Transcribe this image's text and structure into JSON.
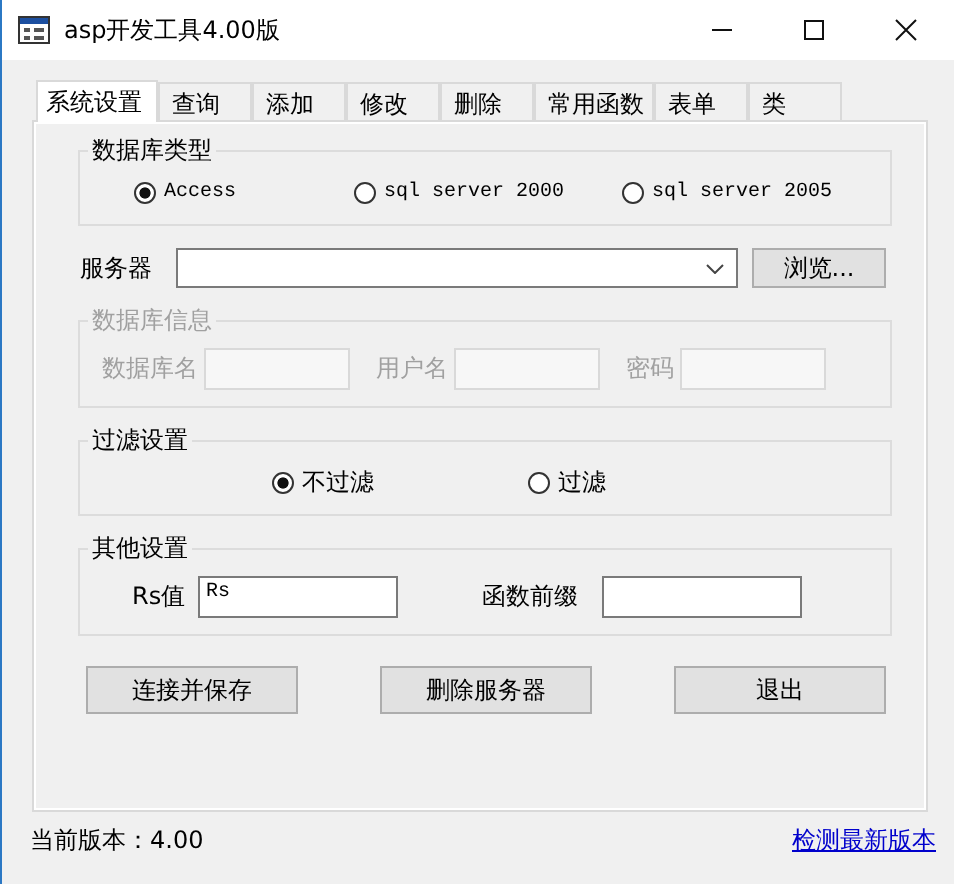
{
  "window": {
    "title": "asp开发工具4.00版"
  },
  "tabs": [
    {
      "label": "系统设置",
      "selected": true
    },
    {
      "label": "查询",
      "selected": false
    },
    {
      "label": "添加",
      "selected": false
    },
    {
      "label": "修改",
      "selected": false
    },
    {
      "label": "删除",
      "selected": false
    },
    {
      "label": "常用函数",
      "selected": false
    },
    {
      "label": "表单",
      "selected": false
    },
    {
      "label": "类",
      "selected": false
    }
  ],
  "db_type": {
    "title": "数据库类型",
    "options": [
      {
        "label": "Access",
        "selected": true
      },
      {
        "label": "sql server 2000",
        "selected": false
      },
      {
        "label": "sql server 2005",
        "selected": false
      }
    ]
  },
  "server": {
    "label": "服务器",
    "browse_button": "浏览..."
  },
  "db_info": {
    "title": "数据库信息",
    "disabled": true,
    "fields": [
      {
        "label": "数据库名"
      },
      {
        "label": "用户名"
      },
      {
        "label": "密码"
      }
    ]
  },
  "filter": {
    "title": "过滤设置",
    "options": [
      {
        "label": "不过滤",
        "selected": true
      },
      {
        "label": "过滤",
        "selected": false
      }
    ]
  },
  "other": {
    "title": "其他设置",
    "fields": [
      {
        "label": "Rs值",
        "value": "Rs"
      },
      {
        "label": "函数前缀"
      }
    ]
  },
  "buttons": [
    "连接并保存",
    "删除服务器",
    "退出"
  ],
  "status_bar": {
    "version": "当前版本：4.00",
    "update_link": "检测最新版本"
  }
}
